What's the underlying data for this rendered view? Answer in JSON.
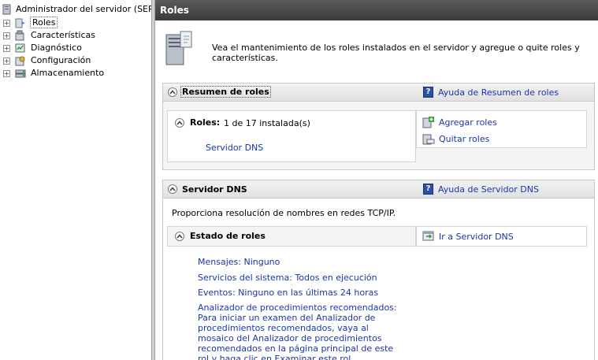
{
  "tree": {
    "root_label": "Administrador del servidor (SERVID",
    "items": [
      {
        "label": "Roles",
        "icon": "roles-icon"
      },
      {
        "label": "Características",
        "icon": "features-icon"
      },
      {
        "label": "Diagnóstico",
        "icon": "diagnostics-icon"
      },
      {
        "label": "Configuración",
        "icon": "configuration-icon"
      },
      {
        "label": "Almacenamiento",
        "icon": "storage-icon"
      }
    ]
  },
  "header": {
    "title": "Roles"
  },
  "intro": {
    "text": "Vea el mantenimiento de los roles instalados en el servidor y agregue o quite roles y características."
  },
  "summary": {
    "title": "Resumen de roles",
    "help_link": "Ayuda de Resumen de roles",
    "roles_label": "Roles:",
    "roles_count": "1 de 17 instalada(s)",
    "role_link": "Servidor DNS",
    "add_roles": "Agregar roles",
    "remove_roles": "Quitar roles"
  },
  "dns": {
    "title": "Servidor DNS",
    "help_link": "Ayuda de Servidor DNS",
    "description": "Proporciona resolución de nombres en redes TCP/IP.",
    "status_title": "Estado de roles",
    "goto_link": "Ir a Servidor DNS",
    "messages": "Mensajes: Ninguno",
    "services": "Servicios del sistema: Todos en ejecución",
    "events": "Eventos: Ninguno en las últimas 24 horas",
    "bpa": "Analizador de procedimientos recomendados: Para iniciar un examen del Analizador de procedimientos recomendados, vaya al mosaico del Analizador de procedimientos recomendados en la página principal de este rol y haga clic en Examinar este rol."
  }
}
